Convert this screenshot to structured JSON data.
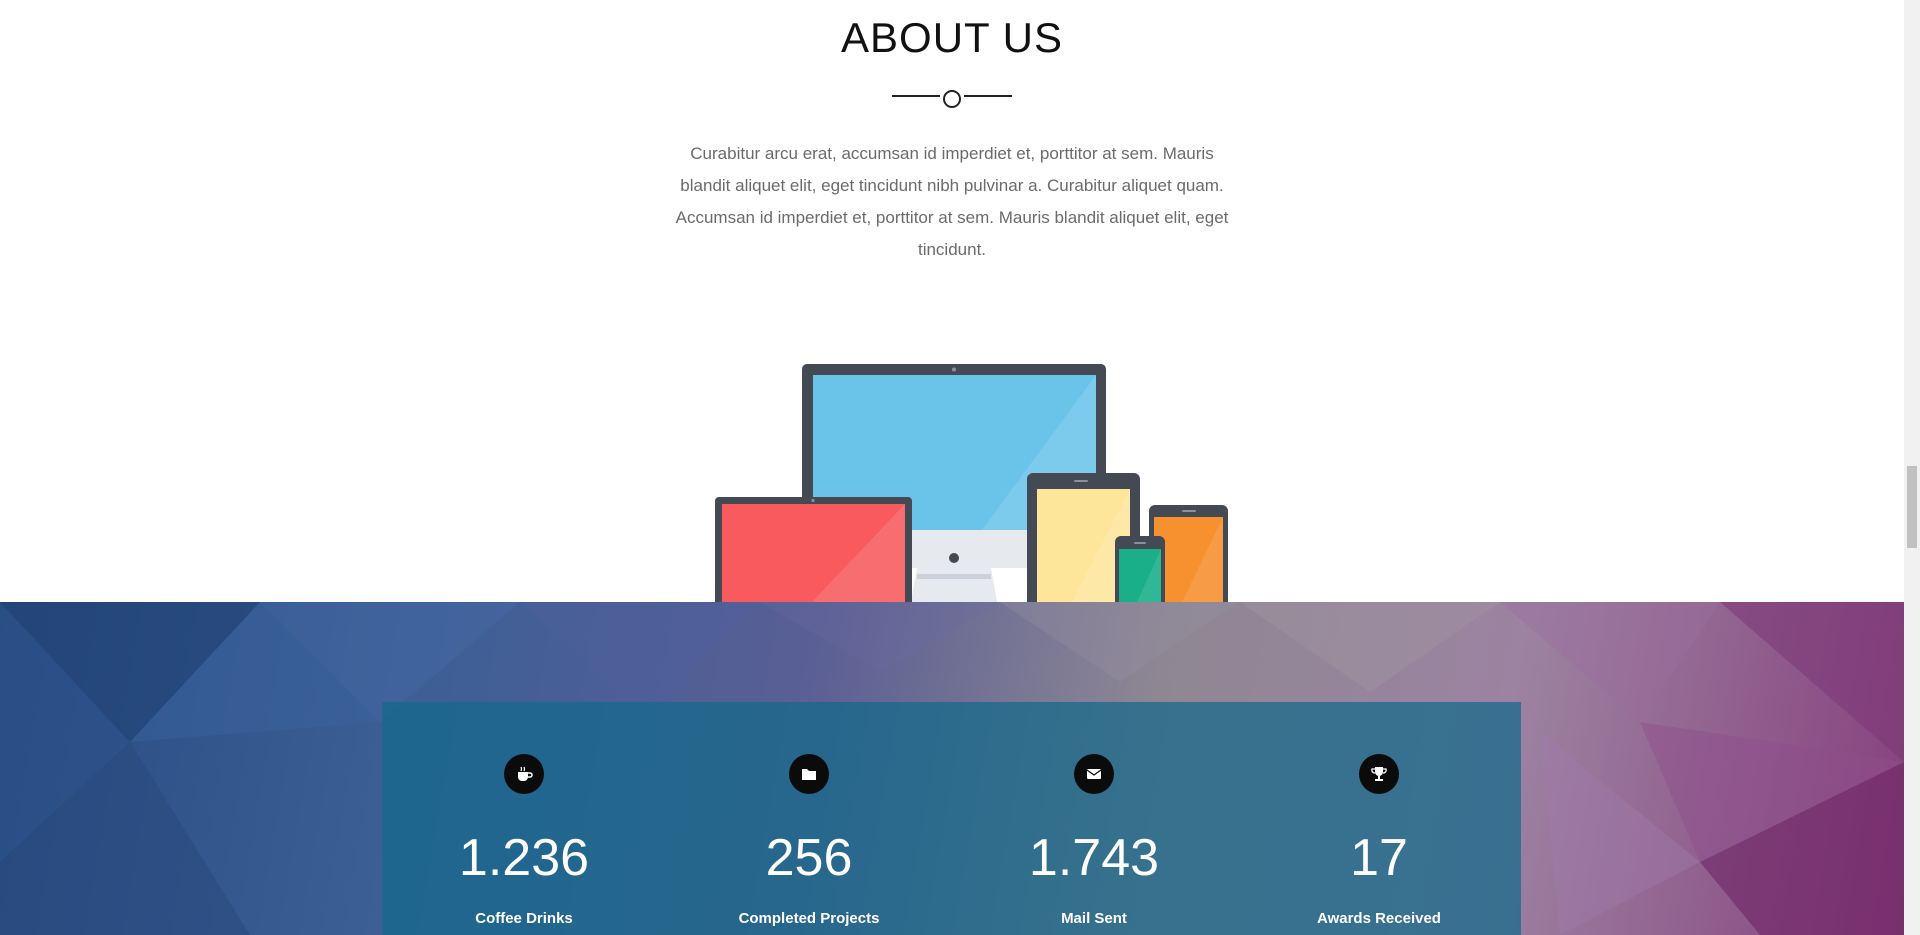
{
  "about": {
    "title": "ABOUT US",
    "text": "Curabitur arcu erat, accumsan id imperdiet et, porttitor at sem. Mauris blandit aliquet elit, eget tincidunt nibh pulvinar a. Curabitur aliquet quam. Accumsan id imperdiet et, porttitor at sem. Mauris blandit aliquet elit, eget tincidunt."
  },
  "stats": [
    {
      "icon": "coffee-icon",
      "value": "1.236",
      "label": "Coffee Drinks"
    },
    {
      "icon": "folder-icon",
      "value": "256",
      "label": "Completed Projects"
    },
    {
      "icon": "envelope-icon",
      "value": "1.743",
      "label": "Mail Sent"
    },
    {
      "icon": "trophy-icon",
      "value": "17",
      "label": "Awards Received"
    }
  ],
  "colors": {
    "panel": "#14698a",
    "monitor_screen": "#6ac4ea",
    "laptop_screen": "#f85a5d",
    "tablet_screen": "#fde59a",
    "phone_green": "#1aaf89",
    "phone_orange": "#f7902f",
    "device_frame": "#434a54"
  }
}
